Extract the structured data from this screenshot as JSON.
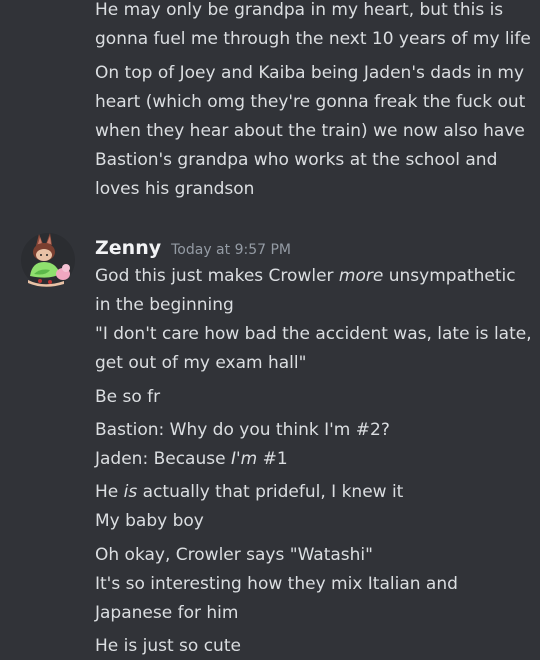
{
  "messages_prev": {
    "lines": [
      "He may only be grandpa in my heart, but this is",
      "gonna fuel me through the next 10 years of my life",
      "On top of Joey and Kaiba being Jaden's dads in my",
      "heart (which omg they're gonna freak the fuck out",
      "when they hear about the train) we now also have",
      "Bastion's grandpa who works at the school and",
      "loves his grandson"
    ]
  },
  "message_group": {
    "username": "Zenny",
    "timestamp": "Today at 9:57 PM",
    "avatar_icon": "bunny-character-avatar-icon",
    "lines": {
      "m1_a": "God this just makes Crowler ",
      "m1_em": "more",
      "m1_b": " unsympathetic",
      "m1_l2": "in the beginning",
      "m1_l3": "\"I don't care how bad the accident was, late is late,",
      "m1_l4": "get out of my exam hall\"",
      "m2": "Be so fr",
      "m3_l1": "Bastion: Why do you think I'm #2?",
      "m3_l2_a": "Jaden: Because ",
      "m3_l2_em": "I'm",
      "m3_l2_b": " #1",
      "m4_a": "He ",
      "m4_em": "is",
      "m4_b": " actually that prideful, I knew it",
      "m4_l2": "My baby boy",
      "m5_l1": "Oh okay, Crowler says \"Watashi\"",
      "m5_l2": "It's so interesting how they mix Italian and",
      "m5_l3": "Japanese for him",
      "m6": "He is just so cute"
    }
  },
  "colors": {
    "background": "#313338",
    "text": "#dbdee1",
    "username": "#f2f3f5",
    "timestamp": "#949ba4"
  }
}
